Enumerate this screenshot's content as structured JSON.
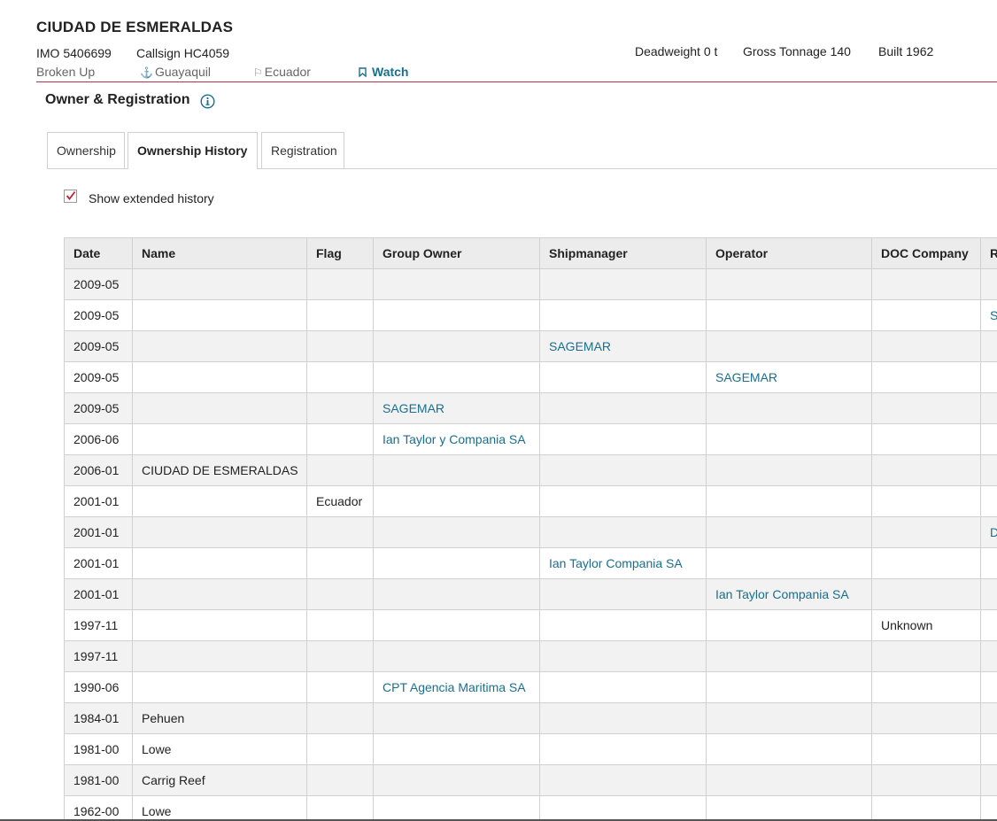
{
  "vessel": {
    "name": "CIUDAD DE ESMERALDAS",
    "imo": "IMO 5406699",
    "callsign": "Callsign HC4059",
    "status": "Broken Up",
    "port": "Guayaquil",
    "flag": "Ecuador",
    "watch_label": "Watch",
    "deadweight": "Deadweight 0 t",
    "gross_tonnage": "Gross Tonnage 140",
    "built": "Built 1962"
  },
  "section": {
    "title": "Owner & Registration"
  },
  "tabs": [
    {
      "label": "Ownership",
      "active": false
    },
    {
      "label": "Ownership History",
      "active": true
    },
    {
      "label": "Registration",
      "active": false
    }
  ],
  "extended_history": {
    "label": "Show extended history",
    "checked": true
  },
  "table": {
    "headers": [
      "Date",
      "Name",
      "Flag",
      "Group Owner",
      "Shipmanager",
      "Operator",
      "DOC Company",
      "R"
    ],
    "rows": [
      [
        "2009-05",
        "",
        "",
        "",
        "",
        "",
        "",
        ""
      ],
      [
        "2009-05",
        "",
        "",
        "",
        "",
        "",
        "",
        "S"
      ],
      [
        "2009-05",
        "",
        "",
        "",
        "SAGEMAR",
        "",
        "",
        ""
      ],
      [
        "2009-05",
        "",
        "",
        "",
        "",
        "SAGEMAR",
        "",
        ""
      ],
      [
        "2009-05",
        "",
        "",
        "SAGEMAR",
        "",
        "",
        "",
        ""
      ],
      [
        "2006-06",
        "",
        "",
        "Ian Taylor y Compania SA",
        "",
        "",
        "",
        ""
      ],
      [
        "2006-01",
        "CIUDAD DE ESMERALDAS",
        "",
        "",
        "",
        "",
        "",
        ""
      ],
      [
        "2001-01",
        "",
        "Ecuador",
        "",
        "",
        "",
        "",
        ""
      ],
      [
        "2001-01",
        "",
        "",
        "",
        "",
        "",
        "",
        "D"
      ],
      [
        "2001-01",
        "",
        "",
        "",
        "Ian Taylor Compania SA",
        "",
        "",
        ""
      ],
      [
        "2001-01",
        "",
        "",
        "",
        "",
        "Ian Taylor Compania SA",
        "",
        ""
      ],
      [
        "1997-11",
        "",
        "",
        "",
        "",
        "",
        "Unknown",
        ""
      ],
      [
        "1997-11",
        "",
        "",
        "",
        "",
        "",
        "",
        ""
      ],
      [
        "1990-06",
        "",
        "",
        "CPT Agencia Maritima SA",
        "",
        "",
        "",
        ""
      ],
      [
        "1984-01",
        "Pehuen",
        "",
        "",
        "",
        "",
        "",
        ""
      ],
      [
        "1981-00",
        "Lowe",
        "",
        "",
        "",
        "",
        "",
        ""
      ],
      [
        "1981-00",
        "Carrig Reef",
        "",
        "",
        "",
        "",
        "",
        ""
      ],
      [
        "1962-00",
        "Lowe",
        "",
        "",
        "",
        "",
        "",
        ""
      ]
    ]
  }
}
